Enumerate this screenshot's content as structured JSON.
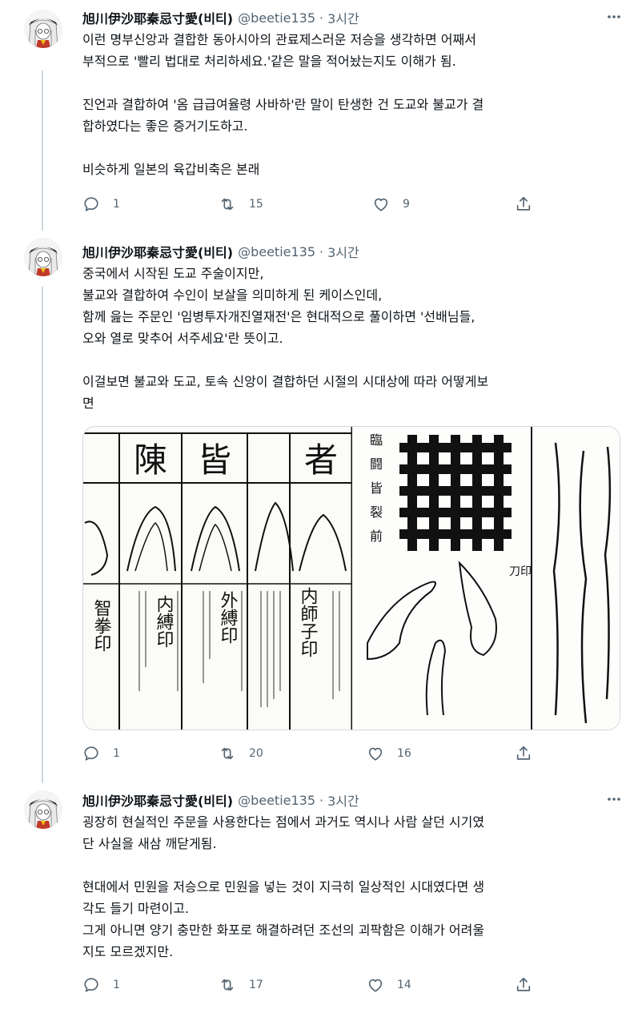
{
  "author": {
    "display_name": "旭川伊沙耶秦忌寸愛(비티)",
    "handle": "@beetie135",
    "avatar_icon": "character-avatar"
  },
  "tweets": [
    {
      "time": "3시간",
      "lines": [
        "이런 명부신앙과 결합한 동아시아의 관료제스러운 저승을 생각하면 어째서",
        "부적으로 '빨리 법대로 처리하세요.'같은 말을 적어놨는지도 이해가 됨.",
        "",
        "진언과 결합하여 '옴 급급여율령 사바하'란 말이 탄생한 건 도교와 불교가 결",
        "합하였다는 좋은 증거기도하고.",
        "",
        "비슷하게 일본의 육갑비축은 본래"
      ],
      "replies": "1",
      "retweets": "15",
      "likes": "9"
    },
    {
      "time": "3시간",
      "lines": [
        "중국에서 시작된 도교 주술이지만,",
        "불교와 결합하여 수인이 보살을 의미하게 된 케이스인데,",
        "함께 읊는 주문인 '임병투자개진열재전'은 현대적으로 풀이하면 '선배님들,",
        "오와 열로 맞추어 서주세요'란 뜻이고.",
        "",
        "이걸보면 불교와 도교, 토속 신앙이 결합하던 시절의 시대상에 따라 어떻게보",
        "면"
      ],
      "image": {
        "left_headers": [
          "陳",
          "皆",
          "者"
        ],
        "left_labels": [
          "智拳印",
          "内縛印",
          "外縛印",
          "内師子印"
        ],
        "right_labels": [
          "臨",
          "闘",
          "皆",
          "裂",
          "前"
        ],
        "right_caption": "刀印"
      },
      "replies": "1",
      "retweets": "20",
      "likes": "16"
    },
    {
      "time": "3시간",
      "lines": [
        "굉장히 현실적인 주문을 사용한다는 점에서 과거도 역시나 사람 살던 시기였",
        "단 사실을 새삼 깨닫게됨.",
        "",
        "현대에서 민원을 저승으로 민원을 넣는 것이 지극히 일상적인 시대였다면 생",
        "각도 들기 마련이고.",
        "그게 아니면 양기 충만한 화포로 해결하려던 조선의 괴팍함은 이해가 어려울",
        "지도 모르겠지만."
      ],
      "replies": "1",
      "retweets": "17",
      "likes": "14"
    }
  ],
  "colors": {
    "text": "#0f1419",
    "secondary": "#536471",
    "border": "#cfd9de"
  },
  "icons": {
    "reply": "reply-icon",
    "retweet": "retweet-icon",
    "like": "like-icon",
    "share": "share-icon",
    "more": "more-icon"
  }
}
